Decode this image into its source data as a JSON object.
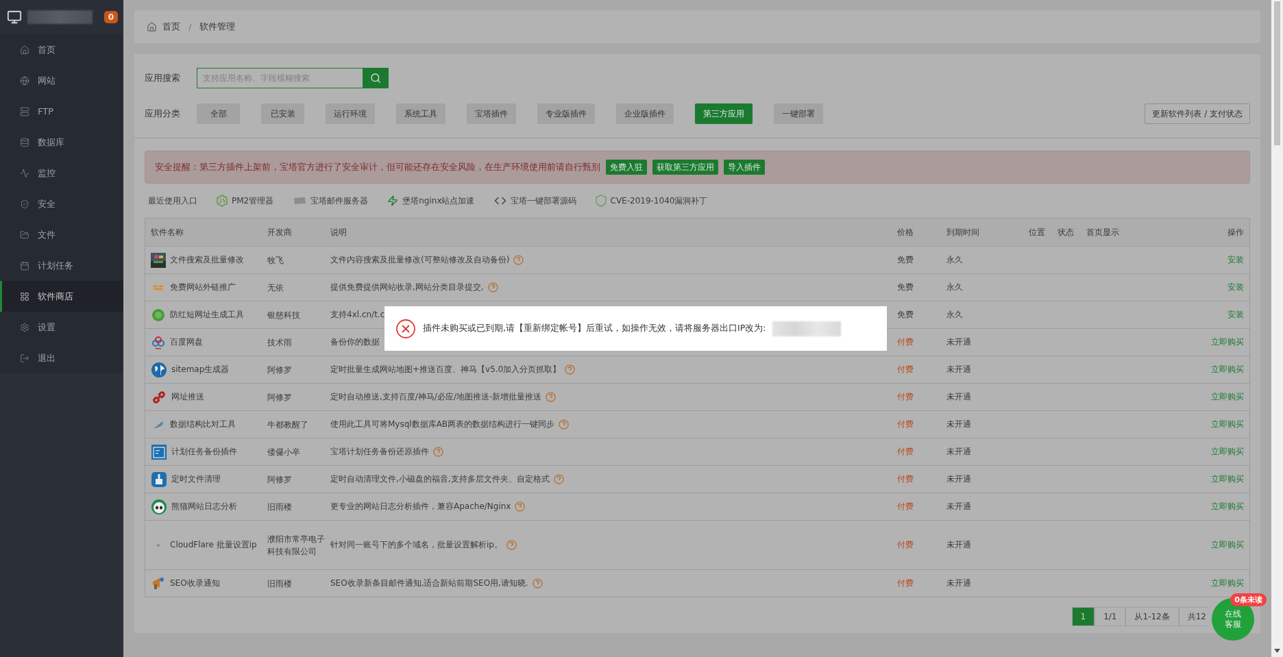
{
  "sidebar": {
    "badge": "0",
    "items": [
      {
        "label": "首页",
        "selected": false
      },
      {
        "label": "网站",
        "selected": false
      },
      {
        "label": "FTP",
        "selected": false
      },
      {
        "label": "数据库",
        "selected": false
      },
      {
        "label": "监控",
        "selected": false
      },
      {
        "label": "安全",
        "selected": false
      },
      {
        "label": "文件",
        "selected": false
      },
      {
        "label": "计划任务",
        "selected": false
      },
      {
        "label": "软件商店",
        "selected": true
      },
      {
        "label": "设置",
        "selected": false
      },
      {
        "label": "退出",
        "selected": false
      }
    ]
  },
  "breadcrumb": {
    "items": [
      "首页",
      "软件管理"
    ],
    "separator": "/"
  },
  "search": {
    "label": "应用搜索",
    "placeholder": "支持应用名称、字段模糊搜索"
  },
  "categories": {
    "label": "应用分类",
    "items": [
      {
        "label": "全部",
        "selected": false
      },
      {
        "label": "已安装",
        "selected": false
      },
      {
        "label": "运行环境",
        "selected": false
      },
      {
        "label": "系统工具",
        "selected": false
      },
      {
        "label": "宝塔插件",
        "selected": false
      },
      {
        "label": "专业版插件",
        "selected": false
      },
      {
        "label": "企业版插件",
        "selected": false
      },
      {
        "label": "第三方应用",
        "selected": true
      },
      {
        "label": "一键部署",
        "selected": false
      }
    ],
    "refresh_button": "更新软件列表 / 支付状态"
  },
  "alert": {
    "text": "安全提醒：第三方插件上架前，宝塔官方进行了安全审计，但可能还存在安全风险，在生产环境使用前请自行甄别",
    "buttons": [
      "免费入驻",
      "获取第三方应用",
      "导入插件"
    ]
  },
  "recent": {
    "label": "最近使用入口",
    "items": [
      "PM2管理器",
      "宝塔邮件服务器",
      "堡塔nginx站点加速",
      "宝塔一键部署源码",
      "CVE-2019-1040漏洞补丁"
    ]
  },
  "table": {
    "columns": [
      "软件名称",
      "开发商",
      "说明",
      "价格",
      "到期时间",
      "位置",
      "状态",
      "首页显示",
      "操作"
    ],
    "rows": [
      {
        "name": "文件搜索及批量修改",
        "developer": "牧飞",
        "description": "文件内容搜索及批量修改(可整站修改及自动备份)",
        "help": true,
        "price": "免费",
        "paid": false,
        "expiry": "永久",
        "action": "安装"
      },
      {
        "name": "免费网站外链推广",
        "developer": "无依",
        "description": "提供免费提供网站收录,网站分类目录提交,",
        "help": true,
        "price": "免费",
        "paid": false,
        "expiry": "永久",
        "action": "安装"
      },
      {
        "name": "防红短网址生成工具",
        "developer": "银慈科技",
        "description": "支持4xl.cn/t.c",
        "help": false,
        "price": "免费",
        "paid": false,
        "expiry": "永久",
        "action": "安装"
      },
      {
        "name": "百度网盘",
        "developer": "技术雨",
        "description": "备份你的数据",
        "help": false,
        "price": "付费",
        "paid": true,
        "expiry": "未开通",
        "action": "立即购买"
      },
      {
        "name": "sitemap生成器",
        "developer": "阿修罗",
        "description": "定时批量生成网站地图+推送百度、神马【v5.0加入分页抓取】",
        "help": true,
        "price": "付费",
        "paid": true,
        "expiry": "未开通",
        "action": "立即购买"
      },
      {
        "name": "网址推送",
        "developer": "阿修罗",
        "description": "定时自动推送,支持百度/神马/必应/地图推送-新增批量推送",
        "help": true,
        "price": "付费",
        "paid": true,
        "expiry": "未开通",
        "action": "立即购买"
      },
      {
        "name": "数据结构比对工具",
        "developer": "牛都教醒了",
        "description": "使用此工具可将Mysql数据库AB两表的数据结构进行一键同步",
        "help": true,
        "price": "付费",
        "paid": true,
        "expiry": "未开通",
        "action": "立即购买"
      },
      {
        "name": "计划任务备份插件",
        "developer": "偻儸小卒",
        "description": "宝塔计划任务备份还原插件",
        "help": true,
        "price": "付费",
        "paid": true,
        "expiry": "未开通",
        "action": "立即购买"
      },
      {
        "name": "定时文件清理",
        "developer": "阿修罗",
        "description": "定时自动清理文件,小磁盘的福音,支持多层文件夹、自定格式",
        "help": true,
        "price": "付费",
        "paid": true,
        "expiry": "未开通",
        "action": "立即购买"
      },
      {
        "name": "熊猫网站日志分析",
        "developer": "旧雨楼",
        "description": "更专业的网站日志分析插件，兼容Apache/Nginx",
        "help": true,
        "price": "付费",
        "paid": true,
        "expiry": "未开通",
        "action": "立即购买"
      },
      {
        "name": "CloudFlare 批量设置ip",
        "developer": "濮阳市常亭电子科技有限公司",
        "description": "针对同一账号下的多个域名，批量设置解析ip。",
        "help": true,
        "price": "付费",
        "paid": true,
        "expiry": "未开通",
        "action": "立即购买"
      },
      {
        "name": "SEO收录通知",
        "developer": "旧雨楼",
        "description": "SEO收录新条目邮件通知,适合新站前期SEO用,请知晓.",
        "help": true,
        "price": "付费",
        "paid": true,
        "expiry": "未开通",
        "action": "立即购买"
      }
    ]
  },
  "pagination": [
    {
      "label": "1",
      "selected": true
    },
    {
      "label": "1/1",
      "selected": false
    },
    {
      "label": "从1-12条",
      "selected": false
    },
    {
      "label": "共12",
      "selected": false
    }
  ],
  "chat": {
    "label": "在线客服",
    "badge": "0条未读"
  },
  "modal": {
    "message": "插件未购买或已到期,请【重新绑定帐号】后重试，如操作无效，请将服务器出口IP改为:"
  }
}
